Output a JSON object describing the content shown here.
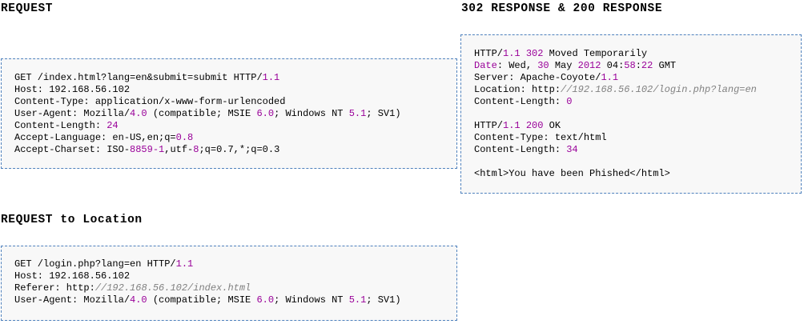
{
  "headings": {
    "request": "REQUEST",
    "response": "302 RESPONSE & 200 RESPONSE",
    "location": "REQUEST to Location"
  },
  "request": {
    "lines": [
      [
        {
          "t": "GET /index.html?lang=en&submit=submit HTTP/",
          "c": "plain"
        },
        {
          "t": "1.1",
          "c": "num"
        }
      ],
      [
        {
          "t": "Host: 192.168.56.102",
          "c": "plain"
        }
      ],
      [
        {
          "t": "Content-Type: application/x-www-form-urlencoded",
          "c": "plain"
        }
      ],
      [
        {
          "t": "User-Agent: Mozilla/",
          "c": "plain"
        },
        {
          "t": "4.0",
          "c": "num"
        },
        {
          "t": " (compatible; MSIE ",
          "c": "plain"
        },
        {
          "t": "6.0",
          "c": "num"
        },
        {
          "t": "; Windows NT ",
          "c": "plain"
        },
        {
          "t": "5.1",
          "c": "num"
        },
        {
          "t": "; SV1)",
          "c": "plain"
        }
      ],
      [
        {
          "t": "Content-Length: ",
          "c": "plain"
        },
        {
          "t": "24",
          "c": "num"
        }
      ],
      [
        {
          "t": "Accept-Language: en-US,en;q=",
          "c": "plain"
        },
        {
          "t": "0.8",
          "c": "num"
        }
      ],
      [
        {
          "t": "Accept-Charset: ISO-",
          "c": "plain"
        },
        {
          "t": "8859-1",
          "c": "num"
        },
        {
          "t": ",utf-",
          "c": "plain"
        },
        {
          "t": "8",
          "c": "num"
        },
        {
          "t": ";q=0.7,*;q=0.3",
          "c": "plain"
        }
      ]
    ]
  },
  "response": {
    "lines": [
      [
        {
          "t": "HTTP/",
          "c": "plain"
        },
        {
          "t": "1.1",
          "c": "num"
        },
        {
          "t": " ",
          "c": "plain"
        },
        {
          "t": "302",
          "c": "num"
        },
        {
          "t": " Moved Temporarily",
          "c": "plain"
        }
      ],
      [
        {
          "t": "Date",
          "c": "num"
        },
        {
          "t": ": Wed, ",
          "c": "plain"
        },
        {
          "t": "30",
          "c": "num"
        },
        {
          "t": " May ",
          "c": "plain"
        },
        {
          "t": "2012",
          "c": "num"
        },
        {
          "t": " 04",
          "c": "plain"
        },
        {
          "t": ":",
          "c": "plain"
        },
        {
          "t": "58",
          "c": "num"
        },
        {
          "t": ":",
          "c": "plain"
        },
        {
          "t": "22",
          "c": "num"
        },
        {
          "t": " GMT",
          "c": "plain"
        }
      ],
      [
        {
          "t": "Server: Apache-Coyote/",
          "c": "plain"
        },
        {
          "t": "1.1",
          "c": "num"
        }
      ],
      [
        {
          "t": "Location: http:",
          "c": "plain"
        },
        {
          "t": "//192.168.56.102/login.php?lang=en",
          "c": "str"
        }
      ],
      [
        {
          "t": "Content-Length: ",
          "c": "plain"
        },
        {
          "t": "0",
          "c": "num"
        }
      ],
      [],
      [
        {
          "t": "HTTP/",
          "c": "plain"
        },
        {
          "t": "1.1",
          "c": "num"
        },
        {
          "t": " ",
          "c": "plain"
        },
        {
          "t": "200",
          "c": "num"
        },
        {
          "t": " OK",
          "c": "plain"
        }
      ],
      [
        {
          "t": "Content-Type: text/html",
          "c": "plain"
        }
      ],
      [
        {
          "t": "Content-Length: ",
          "c": "plain"
        },
        {
          "t": "34",
          "c": "num"
        }
      ],
      [],
      [
        {
          "t": "<html>You have been Phished</html>",
          "c": "plain"
        }
      ]
    ]
  },
  "location": {
    "lines": [
      [
        {
          "t": "GET /login.php?lang=en HTTP/",
          "c": "plain"
        },
        {
          "t": "1.1",
          "c": "num"
        }
      ],
      [
        {
          "t": "Host: 192.168.56.102",
          "c": "plain"
        }
      ],
      [
        {
          "t": "Referer: http:",
          "c": "plain"
        },
        {
          "t": "//192.168.56.102/index.html",
          "c": "str"
        }
      ],
      [
        {
          "t": "User-Agent: Mozilla/",
          "c": "plain"
        },
        {
          "t": "4.0",
          "c": "num"
        },
        {
          "t": " (compatible; MSIE ",
          "c": "plain"
        },
        {
          "t": "6.0",
          "c": "num"
        },
        {
          "t": "; Windows NT ",
          "c": "plain"
        },
        {
          "t": "5.1",
          "c": "num"
        },
        {
          "t": "; SV1)",
          "c": "plain"
        }
      ]
    ]
  },
  "colors": {
    "number": "#990099",
    "comment": "#808080",
    "border": "#4f81bd",
    "box_background": "#f8f8f8"
  }
}
